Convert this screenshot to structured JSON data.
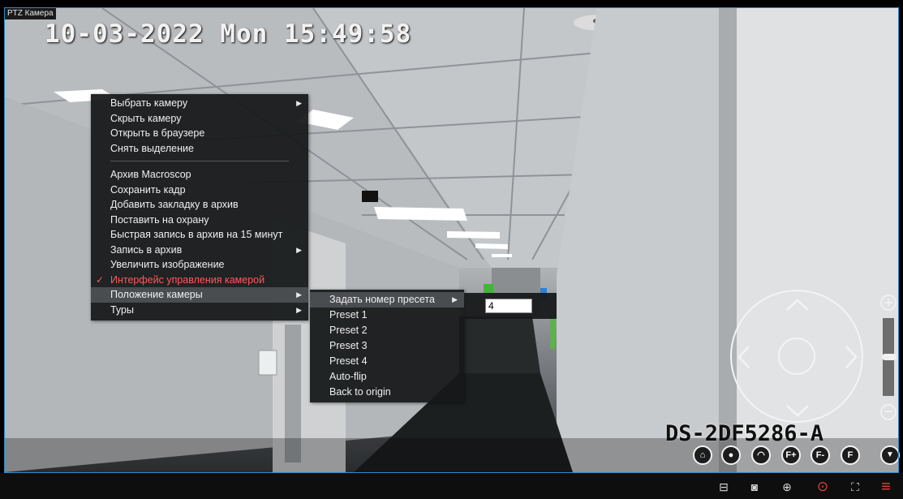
{
  "camera_label": "PTZ Камера",
  "osd": {
    "timestamp": "10-03-2022 Mon 15:49:58",
    "model": "DS-2DF5286-A"
  },
  "context_menu": {
    "items": [
      {
        "label": "Выбрать камеру",
        "submenu": true
      },
      {
        "label": "Скрыть камеру"
      },
      {
        "label": "Открыть в браузере"
      },
      {
        "label": "Снять выделение"
      },
      {
        "label": "Архив Macroscop"
      },
      {
        "label": "Сохранить кадр"
      },
      {
        "label": "Добавить закладку в архив"
      },
      {
        "label": "Поставить на охрану"
      },
      {
        "label": "Быстрая запись в архив на 15 минут"
      },
      {
        "label": "Запись в архив",
        "submenu": true
      },
      {
        "label": "Увеличить изображение"
      },
      {
        "label": "Интерфейс управления камерой",
        "checked": true
      },
      {
        "label": "Положение камеры",
        "submenu": true,
        "highlighted": true
      },
      {
        "label": "Туры",
        "submenu": true
      }
    ],
    "check_mark": "✓",
    "submenu_arrow": "▶"
  },
  "position_submenu": {
    "items": [
      {
        "label": "Задать номер пресета",
        "submenu": true,
        "highlighted": true
      },
      {
        "label": "Preset 1"
      },
      {
        "label": "Preset 2"
      },
      {
        "label": "Preset 3"
      },
      {
        "label": "Preset 4"
      },
      {
        "label": "Auto-flip"
      },
      {
        "label": "Back to origin"
      }
    ],
    "preset_number_value": "4"
  },
  "ptz": {
    "zoom_in": "+",
    "zoom_out": "−",
    "zoom_level_fraction": 0.5,
    "preset_buttons": [
      {
        "icon": "home-icon",
        "glyph": "⌂"
      },
      {
        "icon": "light-icon",
        "glyph": "●"
      },
      {
        "icon": "wiper-icon",
        "glyph": "◠"
      },
      {
        "icon": "focus-near-icon",
        "glyph": "F+"
      },
      {
        "icon": "focus-far-icon",
        "glyph": "F-"
      },
      {
        "icon": "focus-icon",
        "glyph": "F"
      },
      {
        "icon": "collapse-icon",
        "glyph": "▼"
      }
    ]
  },
  "toolbar": {
    "buttons": [
      {
        "icon": "archive-icon",
        "glyph": "⊟"
      },
      {
        "icon": "snapshot-icon",
        "glyph": "◙"
      },
      {
        "icon": "zoom-icon",
        "glyph": "⊕"
      },
      {
        "icon": "ptz-icon",
        "glyph": "⊙",
        "color": "#e0463c"
      },
      {
        "icon": "fullscreen-icon",
        "glyph": "⛶"
      },
      {
        "icon": "menu-icon",
        "glyph": "≡",
        "color": "#e0463c"
      }
    ]
  },
  "colors": {
    "accent_red": "#ff5a5a",
    "border_blue": "#2f89c8"
  }
}
